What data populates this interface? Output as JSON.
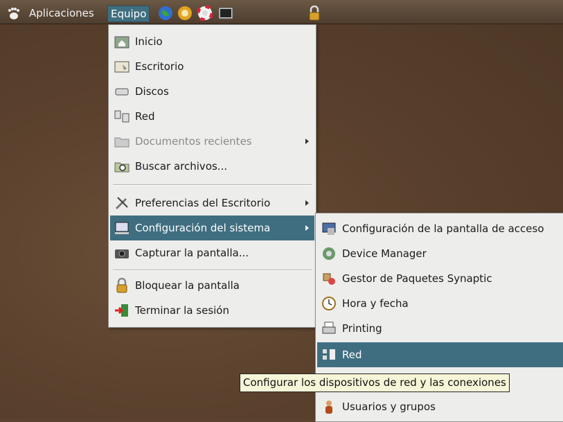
{
  "panel": {
    "applications_label": "Aplicaciones",
    "computer_label": "Equipo",
    "launchers": [
      "web-browser-icon",
      "email-client-icon",
      "help-icon",
      "terminal-icon"
    ],
    "lock_icon": "padlock-icon"
  },
  "computer_menu": {
    "items": [
      {
        "label": "Inicio",
        "icon": "home-folder-icon"
      },
      {
        "label": "Escritorio",
        "icon": "desktop-folder-icon"
      },
      {
        "label": "Discos",
        "icon": "disk-drive-icon"
      },
      {
        "label": "Red",
        "icon": "network-icon"
      },
      {
        "label": "Documentos recientes",
        "icon": "folder-icon",
        "disabled": true,
        "submenu": true
      },
      {
        "label": "Buscar archivos...",
        "icon": "search-folder-icon"
      },
      {
        "label": "Preferencias del Escritorio",
        "icon": "tools-icon",
        "submenu": true
      },
      {
        "label": "Configuración del sistema",
        "icon": "computer-settings-icon",
        "submenu": true,
        "selected": true
      },
      {
        "label": "Capturar la pantalla...",
        "icon": "camera-icon"
      },
      {
        "label": "Bloquear la pantalla",
        "icon": "lock-icon"
      },
      {
        "label": "Terminar la sesión",
        "icon": "logout-icon"
      }
    ]
  },
  "system_submenu": {
    "items": [
      {
        "label": "Configuración de la pantalla de acceso",
        "icon": "login-screen-icon"
      },
      {
        "label": "Device Manager",
        "icon": "device-manager-icon"
      },
      {
        "label": "Gestor de Paquetes Synaptic",
        "icon": "package-manager-icon"
      },
      {
        "label": "Hora y fecha",
        "icon": "clock-icon"
      },
      {
        "label": "Printing",
        "icon": "printer-icon"
      },
      {
        "label": "Red",
        "icon": "network-icon",
        "selected": true
      },
      {
        "label": "Usuarios y grupos",
        "icon": "users-icon"
      }
    ]
  },
  "tooltip": {
    "text": "Configurar los dispositivos de red y las conexiones"
  },
  "colors": {
    "selection": "#3f6e80",
    "menu_bg": "#ededeb",
    "desktop": "#5b4330"
  }
}
